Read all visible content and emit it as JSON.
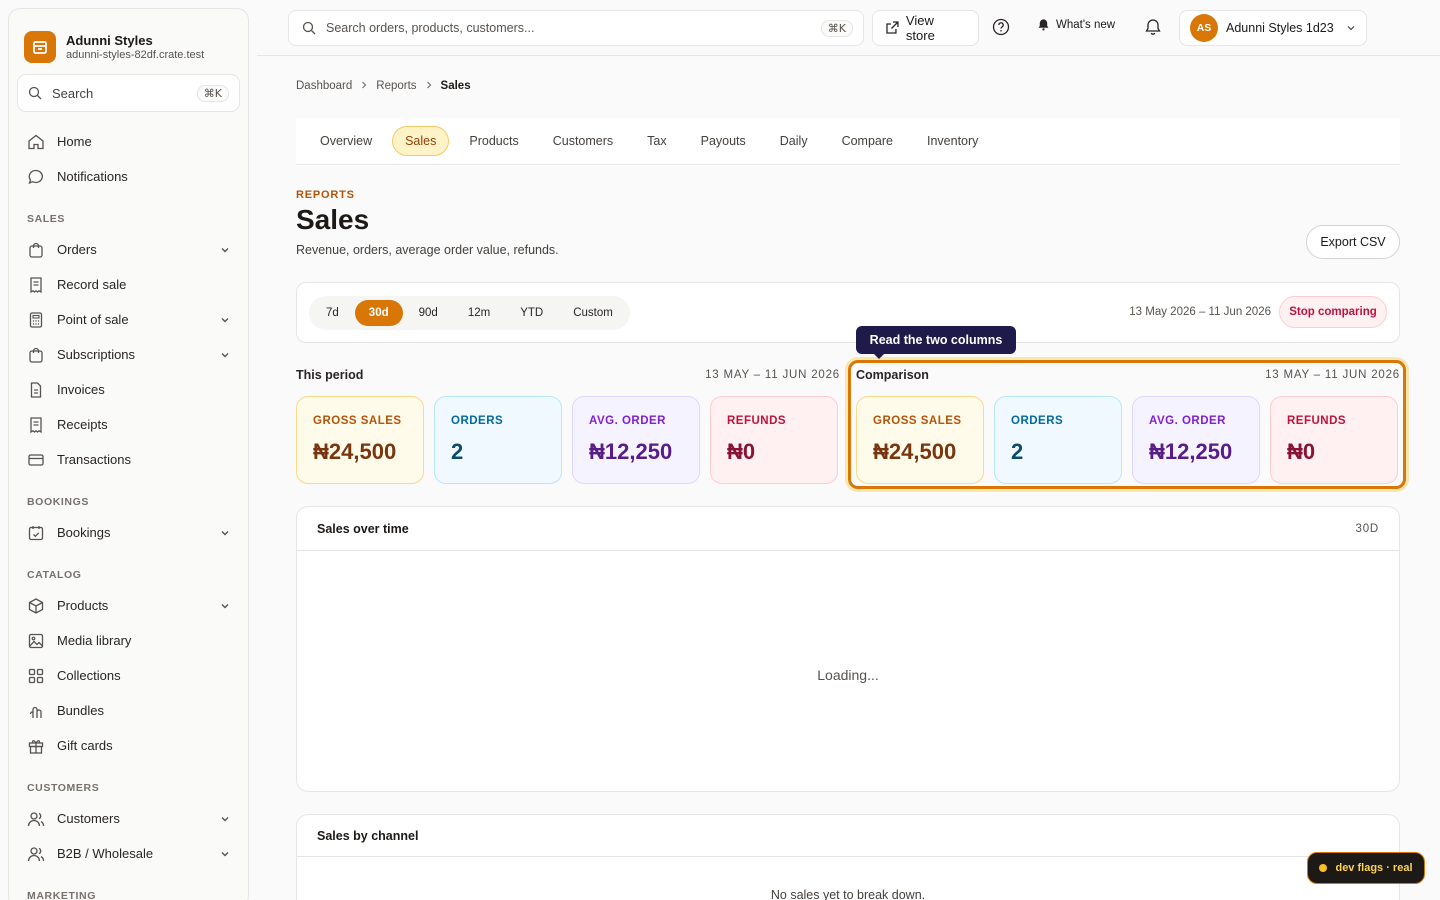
{
  "brand": {
    "name": "Adunni Styles",
    "domain": "adunni-styles-82df.crate.test"
  },
  "sidebar": {
    "search_label": "Search",
    "search_shortcut": "⌘K",
    "items_top": [
      {
        "label": "Home",
        "icon": "home-icon"
      },
      {
        "label": "Notifications",
        "icon": "chat-bubble-icon"
      }
    ],
    "sections": [
      {
        "title": "SALES",
        "items": [
          {
            "label": "Orders",
            "icon": "bag-icon",
            "expandable": true
          },
          {
            "label": "Record sale",
            "icon": "receipt-icon",
            "expandable": false
          },
          {
            "label": "Point of sale",
            "icon": "calculator-icon",
            "expandable": true
          },
          {
            "label": "Subscriptions",
            "icon": "bag-icon",
            "expandable": true
          },
          {
            "label": "Invoices",
            "icon": "document-icon",
            "expandable": false
          },
          {
            "label": "Receipts",
            "icon": "receipt-icon",
            "expandable": false
          },
          {
            "label": "Transactions",
            "icon": "card-icon",
            "expandable": false
          }
        ]
      },
      {
        "title": "BOOKINGS",
        "items": [
          {
            "label": "Bookings",
            "icon": "calendar-check-icon",
            "expandable": true
          }
        ]
      },
      {
        "title": "CATALOG",
        "items": [
          {
            "label": "Products",
            "icon": "box-icon",
            "expandable": true
          },
          {
            "label": "Media library",
            "icon": "image-icon",
            "expandable": false
          },
          {
            "label": "Collections",
            "icon": "grid-icon",
            "expandable": false
          },
          {
            "label": "Bundles",
            "icon": "bundle-icon",
            "expandable": false
          },
          {
            "label": "Gift cards",
            "icon": "gift-icon",
            "expandable": false
          }
        ]
      },
      {
        "title": "CUSTOMERS",
        "items": [
          {
            "label": "Customers",
            "icon": "users-icon",
            "expandable": true
          },
          {
            "label": "B2B / Wholesale",
            "icon": "users-icon",
            "expandable": true
          }
        ]
      },
      {
        "title": "MARKETING",
        "items": []
      }
    ]
  },
  "topbar": {
    "search_placeholder": "Search orders, products, customers...",
    "search_shortcut": "⌘K",
    "view_store": "View store",
    "whats_new": "What's new",
    "avatar_initials": "AS",
    "account_name": "Adunni Styles 1d23"
  },
  "breadcrumb": [
    "Dashboard",
    "Reports",
    "Sales"
  ],
  "tabs": [
    "Overview",
    "Sales",
    "Products",
    "Customers",
    "Tax",
    "Payouts",
    "Daily",
    "Compare",
    "Inventory"
  ],
  "active_tab": "Sales",
  "header": {
    "eyebrow": "REPORTS",
    "title": "Sales",
    "description": "Revenue, orders, average order value, refunds.",
    "export_label": "Export CSV"
  },
  "range": {
    "options": [
      "7d",
      "30d",
      "90d",
      "12m",
      "YTD",
      "Custom"
    ],
    "active": "30d",
    "date_text": "13 May 2026 – 11 Jun 2026",
    "stop_label": "Stop comparing"
  },
  "this_period": {
    "title": "This period",
    "range": "13 MAY – 11 JUN 2026",
    "kpis": [
      {
        "label": "GROSS SALES",
        "value": "₦24,500"
      },
      {
        "label": "ORDERS",
        "value": "2"
      },
      {
        "label": "AVG. ORDER",
        "value": "₦12,250"
      },
      {
        "label": "REFUNDS",
        "value": "₦0"
      }
    ]
  },
  "comparison": {
    "title": "Comparison",
    "range": "13 MAY – 11 JUN 2026",
    "kpis": [
      {
        "label": "GROSS SALES",
        "value": "₦24,500"
      },
      {
        "label": "ORDERS",
        "value": "2"
      },
      {
        "label": "AVG. ORDER",
        "value": "₦12,250"
      },
      {
        "label": "REFUNDS",
        "value": "₦0"
      }
    ]
  },
  "tooltip": "Read the two columns",
  "sales_over_time": {
    "title": "Sales over time",
    "badge": "30D",
    "status": "Loading..."
  },
  "sales_by_channel": {
    "title": "Sales by channel",
    "empty": "No sales yet to break down."
  },
  "dev_flags": "dev flags · real",
  "colors": {
    "accent": "#d97706",
    "tooltip_bg": "#1e1b4b"
  }
}
